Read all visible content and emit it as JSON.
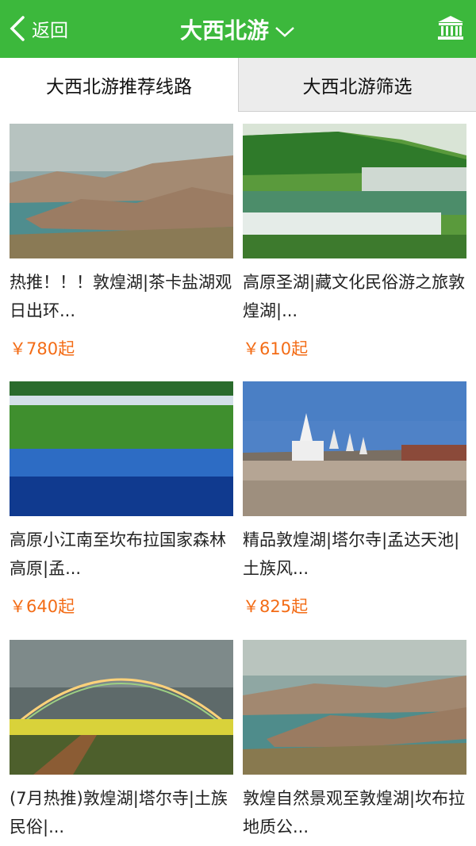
{
  "header": {
    "back_label": "返回",
    "title": "大西北游"
  },
  "tabs": [
    {
      "label": "大西北游推荐线路"
    },
    {
      "label": "大西北游筛选"
    }
  ],
  "products": [
    {
      "name": "热推！！！敦煌湖|茶卡盐湖观日出环...",
      "price": "￥780起"
    },
    {
      "name": "高原圣湖|藏文化民俗游之旅敦煌湖|...",
      "price": "￥610起"
    },
    {
      "name": "高原小江南至坎布拉国家森林高原|孟...",
      "price": "￥640起"
    },
    {
      "name": "精品敦煌湖|塔尔寺|孟达天池|土族风...",
      "price": "￥825起"
    },
    {
      "name": "(7月热推)敦煌湖|塔尔寺|土族民俗|...",
      "price": ""
    },
    {
      "name": "敦煌自然景观至敦煌湖|坎布拉地质公...",
      "price": ""
    }
  ]
}
